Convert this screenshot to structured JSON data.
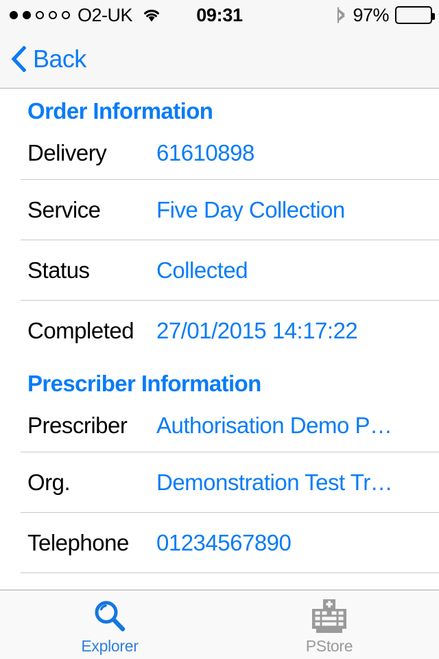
{
  "status_bar": {
    "signal_dots_total": 5,
    "signal_dots_filled": 2,
    "carrier": "O2-UK",
    "wifi_icon": "wifi-icon",
    "time": "09:31",
    "bluetooth_icon": "bluetooth-icon",
    "battery_percent": "97%",
    "battery_level": 93
  },
  "nav_bar": {
    "back_icon": "chevron-left-icon",
    "back_label": "Back"
  },
  "colors": {
    "accent_blue": "#0a7cf7",
    "tab_active": "#2f7fe0",
    "tab_inactive": "#9a9a9a",
    "separator": "#c8c8c8",
    "chrome_bg": "#f7f7f7"
  },
  "sections": [
    {
      "header": "Order Information",
      "rows": [
        {
          "label": "Delivery",
          "value": "61610898"
        },
        {
          "label": "Service",
          "value": "Five Day Collection"
        },
        {
          "label": "Status",
          "value": "Collected"
        },
        {
          "label": "Completed",
          "value": "27/01/2015 14:17:22"
        }
      ]
    },
    {
      "header": "Prescriber Information",
      "rows": [
        {
          "label": "Prescriber",
          "value": "Authorisation Demo P…"
        },
        {
          "label": "Org.",
          "value": "Demonstration Test Tr…"
        },
        {
          "label": "Telephone",
          "value": "01234567890"
        }
      ]
    }
  ],
  "tab_bar": {
    "tabs": [
      {
        "label": "Explorer",
        "icon": "magnifying-glass-icon",
        "active": true
      },
      {
        "label": "PStore",
        "icon": "hospital-building-icon",
        "active": false
      }
    ]
  }
}
